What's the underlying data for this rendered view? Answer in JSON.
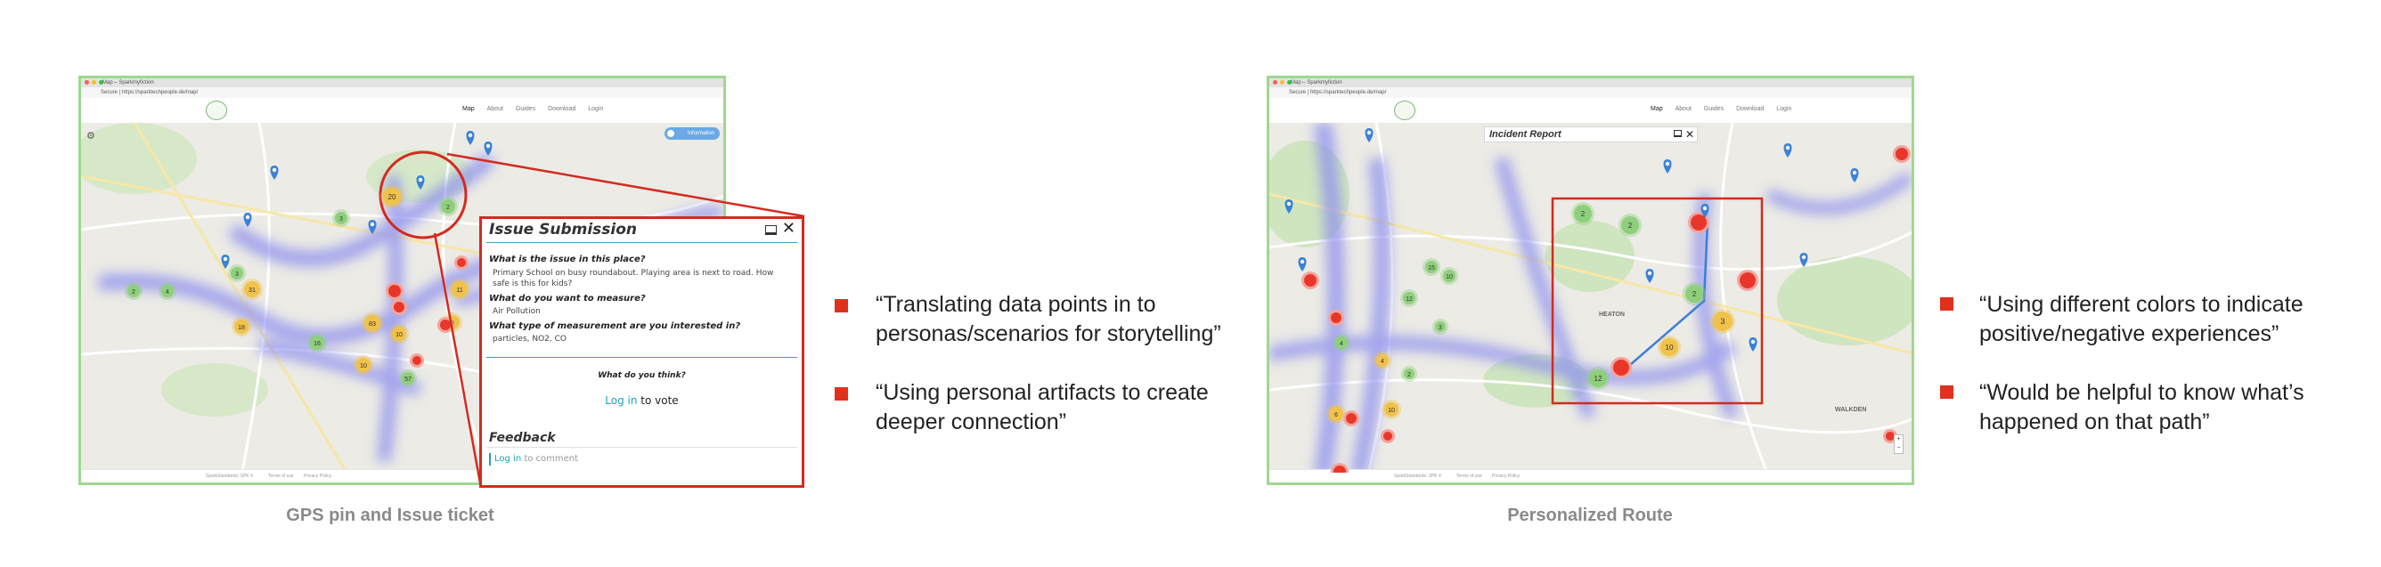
{
  "left_screenshot": {
    "tab_title": "Map – Sparkmyfiction",
    "url": "Secure | https://sparktechpeople.de/map/",
    "nav": [
      "Map",
      "About",
      "Guides",
      "Download",
      "Login"
    ],
    "info_button": "Information",
    "footer": [
      "SparkStandards: SPK 4",
      "Terms of use",
      "Privacy Policy"
    ],
    "clusters": [
      "20",
      "2",
      "3",
      "31",
      "18",
      "16",
      "83",
      "10",
      "10",
      "57",
      "11",
      "6",
      "3",
      "2",
      "4"
    ]
  },
  "issue_panel": {
    "title": "Issue Submission",
    "q1": "What is the issue in this place?",
    "a1": "Primary School on busy roundabout. Playing area is next to road. How safe is this for kids?",
    "q2": "What do you want to measure?",
    "a2": "Air Pollution",
    "q3": "What type of measurement are you interested in?",
    "a3": "particles, NO2, CO",
    "think": "What do you think?",
    "login_vote_link": "Log in",
    "login_vote_rest": " to vote",
    "feedback_title": "Feedback",
    "comment_link": "Log in",
    "comment_rest": " to comment"
  },
  "left_caption": "GPS pin and Issue ticket",
  "left_quotes": [
    "“Translating data points in to personas/scenarios for storytelling”",
    "“Using personal artifacts to create deeper connection”"
  ],
  "right_screenshot": {
    "tab_title": "Map – Sparkmyfiction",
    "url": "Secure | https://sparktechpeople.de/map/",
    "nav": [
      "Map",
      "About",
      "Guides",
      "Download",
      "Login"
    ],
    "incident_title": "Incident Report",
    "footer": [
      "SparkStandards: SPK 4",
      "Terms of use",
      "Privacy Policy"
    ],
    "clusters": [
      "2",
      "2",
      "2",
      "3",
      "10",
      "12",
      "7",
      "3",
      "4",
      "4",
      "6",
      "10",
      "12",
      "15",
      "10",
      "3",
      "2"
    ],
    "place_labels": [
      "HEATON",
      "WALKDEN"
    ],
    "zoom": [
      "+",
      "−"
    ]
  },
  "right_caption": "Personalized Route",
  "right_quotes": [
    "“Using different colors to indicate positive/negative experiences”",
    "“Would be helpful to know what’s happened on that path”"
  ],
  "colors": {
    "frame": "#9fd88f",
    "highlight": "#d42a1f",
    "bullet": "#e0301e",
    "caption": "#8a8a8a",
    "link": "#1aa6b5",
    "cluster_green": "#8fcf7c",
    "cluster_yellow": "#f0c24a",
    "incident_red": "#e8372a"
  }
}
